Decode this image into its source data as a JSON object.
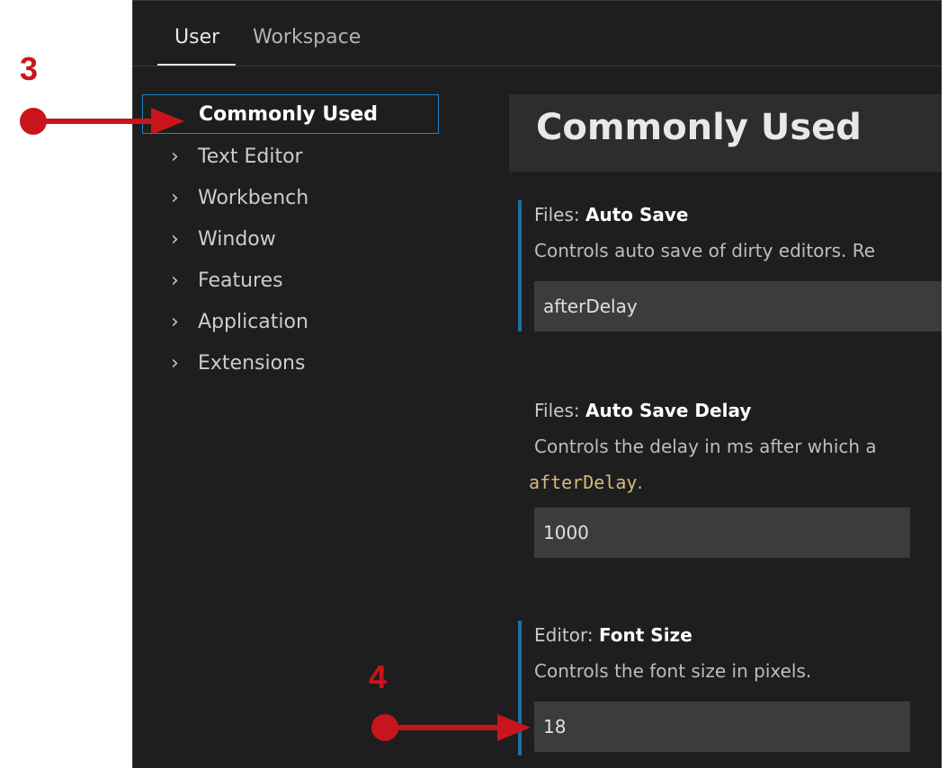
{
  "tabs": [
    {
      "label": "User"
    },
    {
      "label": "Workspace"
    }
  ],
  "sidebar": {
    "items": [
      {
        "label": "Commonly Used",
        "selected": true
      },
      {
        "label": "Text Editor"
      },
      {
        "label": "Workbench"
      },
      {
        "label": "Window"
      },
      {
        "label": "Features"
      },
      {
        "label": "Application"
      },
      {
        "label": "Extensions"
      }
    ],
    "chevron_icon": "chevron-right-icon"
  },
  "content": {
    "title": "Commonly Used",
    "settings": [
      {
        "category": "Files: ",
        "key": "Auto Save",
        "description": "Controls auto save of dirty editors. Re",
        "value": "afterDelay"
      },
      {
        "category": "Files: ",
        "key": "Auto Save Delay",
        "description": "Controls the delay in ms after which a",
        "code": "afterDelay",
        "code_suffix": ".",
        "value": "1000"
      },
      {
        "category": "Editor: ",
        "key": "Font Size",
        "description": "Controls the font size in pixels.",
        "value": "18"
      }
    ]
  },
  "annotations": {
    "step3": "3",
    "step4": "4",
    "color": "#c8151b"
  },
  "colors": {
    "background": "#1e1e1e",
    "focus_border": "#1c86c7",
    "modified_bar": "#1c6fa0",
    "input_bg": "#3c3c3c"
  }
}
